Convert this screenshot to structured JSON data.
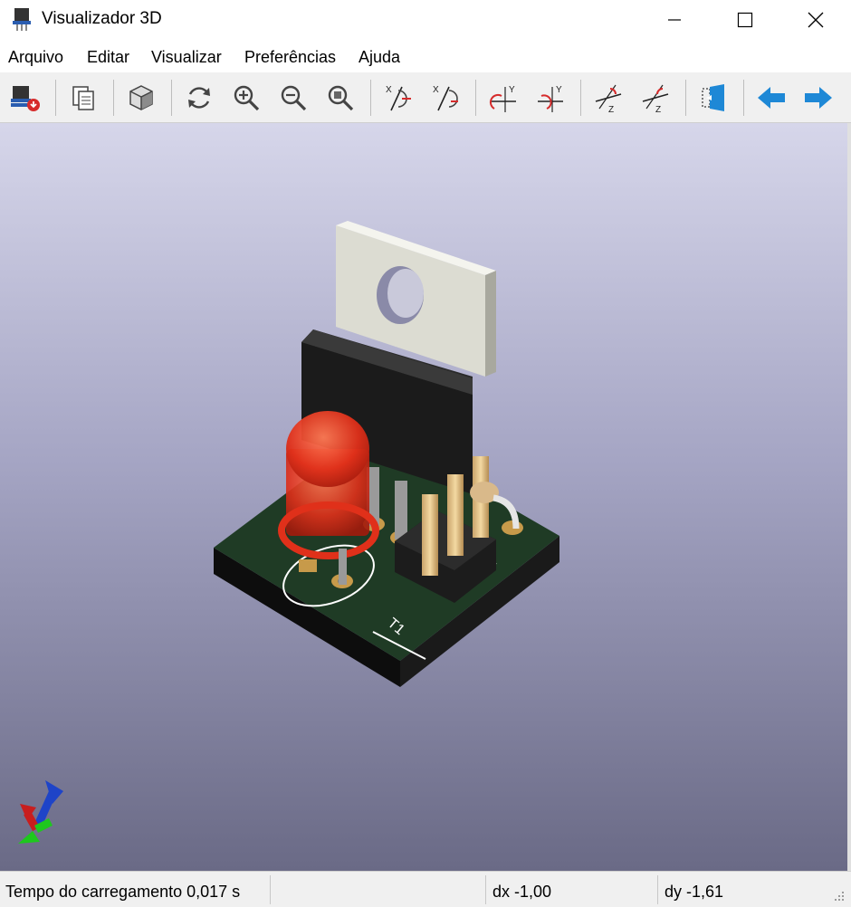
{
  "window": {
    "title": "Visualizador 3D"
  },
  "menu": {
    "items": [
      "Arquivo",
      "Editar",
      "Visualizar",
      "Preferências",
      "Ajuda"
    ]
  },
  "toolbar": {
    "buttons": [
      "reload-board-icon",
      "copy-image-icon",
      "raytrace-view-icon",
      "redraw-icon",
      "zoom-in-icon",
      "zoom-out-icon",
      "zoom-fit-icon",
      "rotate-x-cw-icon",
      "rotate-x-ccw-icon",
      "rotate-y-cw-icon",
      "rotate-y-ccw-icon",
      "rotate-z-cw-icon",
      "rotate-z-ccw-icon",
      "flip-board-icon",
      "move-left-icon",
      "move-right-icon"
    ],
    "axis_labels": {
      "x": "X",
      "y": "Y",
      "z": "Z"
    }
  },
  "statusbar": {
    "load_time": "Tempo do carregamento 0,017 s",
    "dx": "dx -1,00",
    "dy": "dy -1,61"
  },
  "colors": {
    "accent_blue": "#1e88d6",
    "viewport_top": "#d6d6ea",
    "viewport_bottom": "#6a6a86",
    "led_red": "#e0301a",
    "pcb_green": "#1e3a22"
  }
}
